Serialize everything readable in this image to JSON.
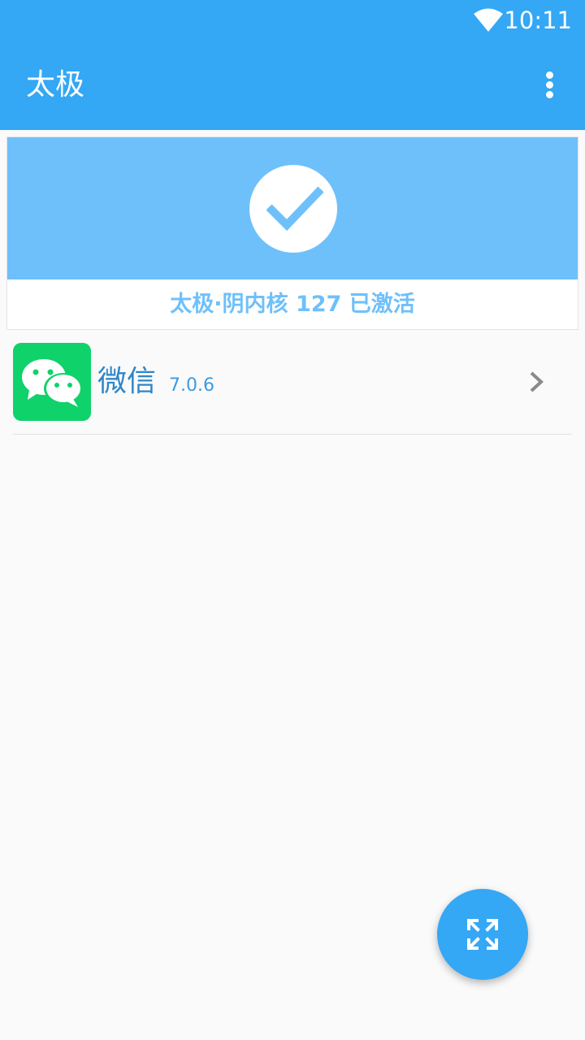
{
  "status_bar": {
    "time": "10:11",
    "wifi_icon": "wifi-icon"
  },
  "toolbar": {
    "title": "太极",
    "more_icon": "more-vertical-icon"
  },
  "colors": {
    "primary": "#34a7f5",
    "banner": "#6ec0fb",
    "wechat_green": "#0fd26a",
    "background": "#fafafa"
  },
  "status_card": {
    "icon": "check-circle-icon",
    "status_text": "太极·阴内核 127 已激活"
  },
  "apps": [
    {
      "name": "微信",
      "version": "7.0.6",
      "icon": "wechat-icon",
      "chevron_icon": "chevron-right-icon"
    }
  ],
  "fab": {
    "icon": "expand-arrows-icon"
  }
}
